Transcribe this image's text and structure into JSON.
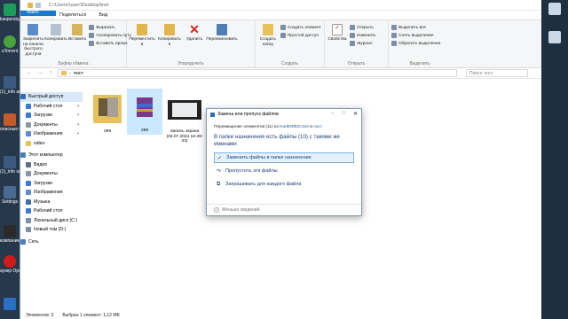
{
  "desktop": {
    "left_icons": [
      {
        "label": "kaspersky",
        "color": "#1b9c5c"
      },
      {
        "label": "uTorrent",
        "color": "#4aa33b"
      },
      {
        "label": "(1)_info activation)",
        "color": "#3c5a80"
      },
      {
        "label": "onасные пелгемия",
        "color": "#c45a28"
      },
      {
        "label": "(1)_info settings)",
        "color": "#3c5a80"
      },
      {
        "label": "Settings",
        "color": "#4a6a90"
      },
      {
        "label": "компанию",
        "color": "#2a2a2a"
      },
      {
        "label": "аузер Opera",
        "color": "#d11a1a"
      },
      {
        "label": "",
        "color": "#2a6fc4"
      }
    ]
  },
  "window": {
    "path": "C:\\Users\\\\user\\Desktop\\tnst",
    "menu": [
      "Файл",
      "Главная",
      "Поделиться",
      "Вид"
    ],
    "ribbon": {
      "clipboard": {
        "name": "Буфер обмена",
        "pin": "Закрепить на панели быстрого доступа",
        "copy": "Копировать",
        "paste": "Вставить",
        "cut": "Вырезать",
        "copy_path": "Скопировать путь",
        "paste_shortcut": "Вставить ярлык"
      },
      "organize": {
        "name": "Упорядочить",
        "move": "Переместить в",
        "copy_to": "Копировать в",
        "delete": "Удалить",
        "rename": "Переименовать"
      },
      "new": {
        "name": "Создать",
        "new_folder": "Создать папку",
        "new_item": "Создать элемент",
        "easy_access": "Простой доступ"
      },
      "open": {
        "name": "Открыть",
        "properties": "Свойства",
        "open": "Открыть",
        "edit": "Изменить",
        "history": "Журнал"
      },
      "select": {
        "name": "Выделить",
        "select_all": "Выделить все",
        "select_none": "Снять выделение",
        "invert": "Обратить выделение"
      }
    },
    "address": {
      "crumb": "пост",
      "search_placeholder": "Поиск: пост"
    },
    "nav": [
      {
        "label": "Быстрый доступ",
        "icon": "star-icon",
        "color": "#2f6fb3",
        "pinned": false
      },
      {
        "label": "Рабочий стол",
        "icon": "desktop-icon",
        "color": "#3a7bd5",
        "pinned": true
      },
      {
        "label": "Загрузки",
        "icon": "download-icon",
        "color": "#3a7bd5",
        "pinned": true
      },
      {
        "label": "Документы",
        "icon": "documents-icon",
        "color": "#8a96a8",
        "pinned": true
      },
      {
        "label": "Изображения",
        "icon": "pictures-icon",
        "color": "#5a8ccf",
        "pinned": true
      },
      {
        "label": "video",
        "icon": "folder-icon",
        "color": "#e7c25a",
        "pinned": false
      },
      {
        "label": "Этот компьютер",
        "icon": "computer-icon",
        "color": "#4a7fb8",
        "pinned": false
      },
      {
        "label": "Видео",
        "icon": "video-icon",
        "color": "#5a6f8a",
        "pinned": false
      },
      {
        "label": "Документы",
        "icon": "documents-icon",
        "color": "#8a96a8",
        "pinned": false
      },
      {
        "label": "Загрузки",
        "icon": "download-icon",
        "color": "#3a7bd5",
        "pinned": false
      },
      {
        "label": "Изображения",
        "icon": "pictures-icon",
        "color": "#5a8ccf",
        "pinned": false
      },
      {
        "label": "Музыка",
        "icon": "music-icon",
        "color": "#3a6ea8",
        "pinned": false
      },
      {
        "label": "Рабочий стол",
        "icon": "desktop-icon",
        "color": "#3a7bd5",
        "pinned": false
      },
      {
        "label": "Локальный диск (C:)",
        "icon": "drive-icon",
        "color": "#7a8ea6",
        "pinned": false
      },
      {
        "label": "Новый том (D:)",
        "icon": "drive-icon",
        "color": "#7a8ea6",
        "pinned": false
      },
      {
        "label": "Сеть",
        "icon": "network-icon",
        "color": "#4a7fb8",
        "pinned": false
      }
    ],
    "files": [
      {
        "name": "299",
        "type": "folder"
      },
      {
        "name": "299",
        "type": "archive"
      },
      {
        "name": "Запись экрана (03.07.2024 16-49-33)",
        "type": "video"
      }
    ],
    "status": {
      "count": "Элементов: 3",
      "selected": "Выбран 1 элемент: 1,12 МБ"
    }
  },
  "dialog": {
    "title": "Замена или пропуск файлов",
    "progress_prefix": "Перемещение элементов (11) из",
    "progress_source": "Kar5DRlb0.344",
    "progress_mid": "в",
    "progress_dest": "пост",
    "heading": "В папке назначения есть файлы (10) с такими же именами",
    "options": [
      "Заменить файлы в папке назначения",
      "Пропустить эти файлы",
      "Запрашивать для каждого файла"
    ],
    "less_details": "Меньше сведений"
  }
}
